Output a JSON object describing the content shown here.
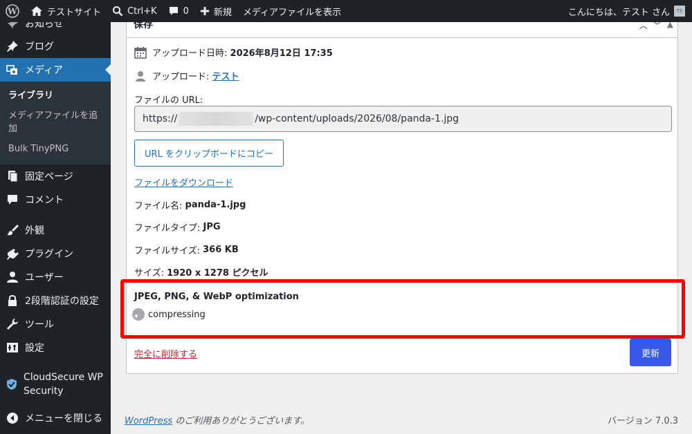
{
  "adminbar": {
    "site_name": "テストサイト",
    "shortcut": "Ctrl+K",
    "comments_count": "0",
    "new_label": "新規",
    "view_media": "メディアファイルを表示",
    "greeting": "こんにちは、テスト さん"
  },
  "sidebar": {
    "notice": "お知らせ",
    "posts": "ブログ",
    "media": "メディア",
    "media_sub": [
      "ライブラリ",
      "メディアファイルを追加",
      "Bulk TinyPNG"
    ],
    "pages": "固定ページ",
    "comments": "コメント",
    "appearance": "外観",
    "plugins": "プラグイン",
    "users": "ユーザー",
    "twofactor": "2段階認証の設定",
    "tools": "ツール",
    "settings": "設定",
    "cloudsecure": "CloudSecure WP Security",
    "collapse": "メニューを閉じる"
  },
  "postbox": {
    "title": "保存",
    "uploaded_label": "アップロード日時:",
    "uploaded_value": "2026年8月12日 17:35",
    "uploader_label": "アップロード:",
    "uploader_value": "テスト",
    "url_label": "ファイルの URL:",
    "url_prefix": "https://",
    "url_suffix": "/wp-content/uploads/2026/08/panda-1.jpg",
    "copy_button": "URL をクリップボードにコピー",
    "download_link": "ファイルをダウンロード",
    "filename_label": "ファイル名:",
    "filename_value": "panda-1.jpg",
    "filetype_label": "ファイルタイプ:",
    "filetype_value": "JPG",
    "filesize_label": "ファイルサイズ:",
    "filesize_value": "366 KB",
    "dimensions_label": "サイズ:",
    "dimensions_value": "1920 x 1278 ピクセル",
    "optimization_title": "JPEG, PNG, & WebP optimization",
    "optimization_status": "compressing",
    "delete_link": "完全に削除する",
    "update_button": "更新"
  },
  "footer": {
    "wordpress_link": "WordPress",
    "thanks": " のご利用ありがとうございます。",
    "version": "バージョン 7.0.3"
  },
  "colors": {
    "adminbar_bg": "#1d2327",
    "active_menu": "#2271b1",
    "highlight": "#ff0000",
    "update_button": "#3858e9"
  }
}
